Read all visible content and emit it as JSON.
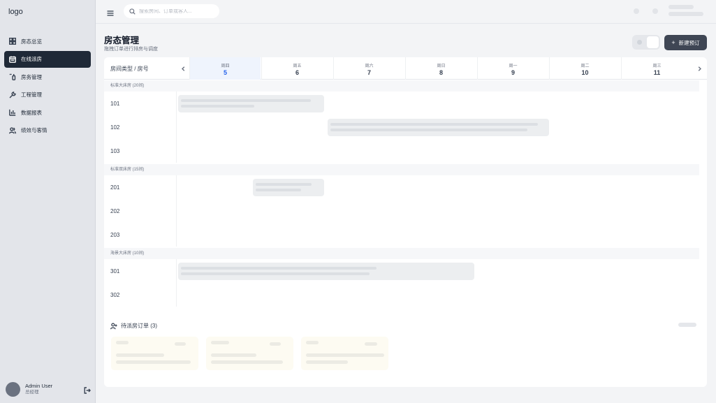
{
  "sidebar": {
    "logo": "logo",
    "items": [
      {
        "label": "房态总览",
        "icon": "dashboard-grid-icon",
        "active": false
      },
      {
        "label": "在线派房",
        "icon": "calendar-icon",
        "active": true
      },
      {
        "label": "房务管理",
        "icon": "broom-icon",
        "active": false
      },
      {
        "label": "工程管理",
        "icon": "wrench-icon",
        "active": false
      },
      {
        "label": "数据报表",
        "icon": "bar-chart-icon",
        "active": false
      },
      {
        "label": "绩效与客情",
        "icon": "users-icon",
        "active": false
      }
    ],
    "user": {
      "name": "Admin User",
      "role": "总经理"
    }
  },
  "topbar": {
    "search_placeholder": "搜索房间、订单或客人..."
  },
  "page": {
    "title": "房态管理",
    "subtitle": "拖拽订单进行排房与调度",
    "new_booking_label": "新建预订"
  },
  "calendar": {
    "column_label": "房间类型 / 房号",
    "days": [
      {
        "dow": "周四",
        "num": "5",
        "today": true
      },
      {
        "dow": "周五",
        "num": "6",
        "today": false
      },
      {
        "dow": "周六",
        "num": "7",
        "today": false
      },
      {
        "dow": "周日",
        "num": "8",
        "today": false
      },
      {
        "dow": "周一",
        "num": "9",
        "today": false
      },
      {
        "dow": "周二",
        "num": "10",
        "today": false
      },
      {
        "dow": "周三",
        "num": "11",
        "today": false
      }
    ],
    "groups": [
      {
        "label": "标准大床房 (20间)",
        "rooms": [
          "101",
          "102",
          "103"
        ]
      },
      {
        "label": "标准双床房 (15间)",
        "rooms": [
          "201",
          "202",
          "203"
        ]
      },
      {
        "label": "海景大床房 (10间)",
        "rooms": [
          "301",
          "302"
        ]
      }
    ]
  },
  "pending": {
    "title": "待派房订单 (3)"
  },
  "colors": {
    "accent": "#2563eb",
    "sidebar_active": "#1f2937",
    "primary_button": "#3f4654"
  }
}
